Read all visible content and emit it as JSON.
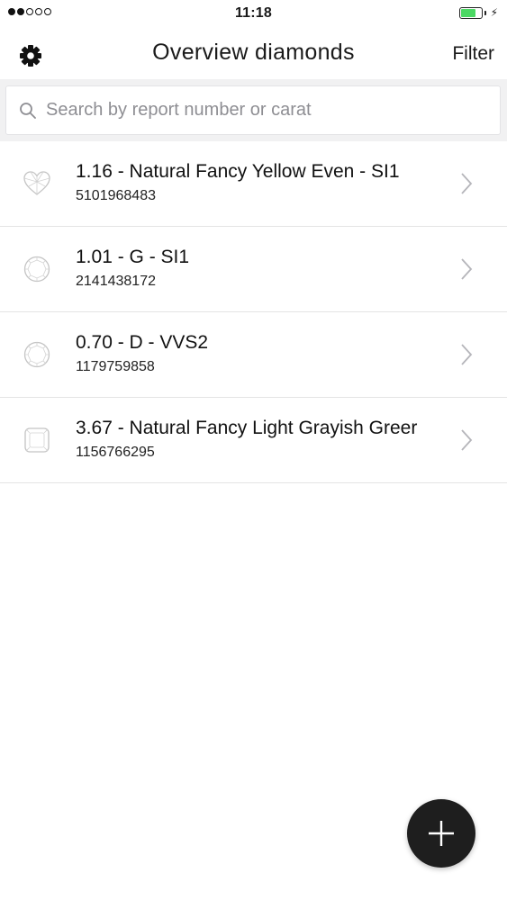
{
  "status_bar": {
    "time": "11:18",
    "signal_dots_filled": 2,
    "signal_dots_total": 5,
    "battery_color": "#4cd964",
    "battery_level": 0.75
  },
  "nav": {
    "title": "Overview diamonds",
    "left_icon": "gear-icon",
    "right_label": "Filter"
  },
  "search": {
    "placeholder": "Search by report number or carat",
    "value": ""
  },
  "diamonds": [
    {
      "title": "1.16 - Natural Fancy Yellow Even - SI1",
      "report": "5101968483",
      "shape_icon": "heart-shape-icon"
    },
    {
      "title": "1.01 - G - SI1",
      "report": "2141438172",
      "shape_icon": "round-shape-icon"
    },
    {
      "title": "0.70 - D - VVS2",
      "report": "1179759858",
      "shape_icon": "round-shape-icon"
    },
    {
      "title": "3.67 - Natural Fancy Light Grayish Greer",
      "report": "1156766295",
      "shape_icon": "cushion-shape-icon"
    }
  ],
  "fab": {
    "icon": "plus-icon",
    "color": "#1e1e1e"
  }
}
